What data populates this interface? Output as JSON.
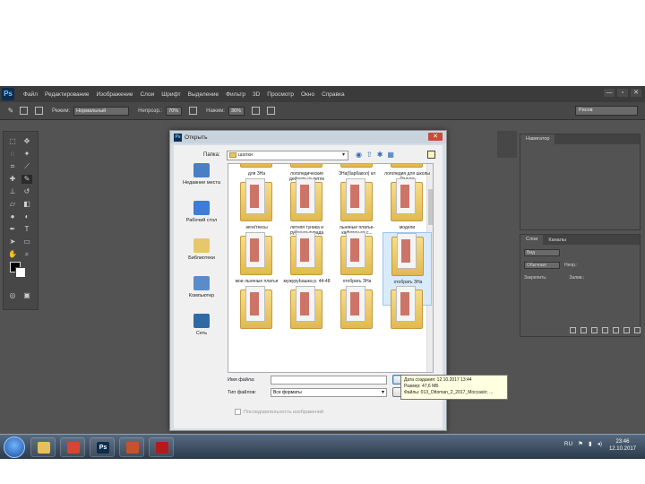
{
  "app": {
    "logo": "Ps",
    "menu": [
      "Файл",
      "Редактирование",
      "Изображение",
      "Слои",
      "Шрифт",
      "Выделение",
      "Фильтр",
      "3D",
      "Просмотр",
      "Окно",
      "Справка"
    ],
    "window_controls": [
      "—",
      "▫",
      "✕"
    ]
  },
  "options_bar": {
    "mode_label": "Режим:",
    "mode_value": "Нормальный",
    "opacity_label": "Непрозр.:",
    "opacity_value": "70%",
    "flow_label": "Нажим:",
    "flow_value": "36%",
    "workspace": "Рисов"
  },
  "panels": {
    "navigator_tab": "Навигатор",
    "layers_tabs": [
      "Слои",
      "Каналы"
    ],
    "layers_kind": "Вид",
    "layers_blend": "Обычные",
    "layers_opacity": "Непр.:",
    "layers_lock": "Закрепить:",
    "layers_fill": "Залив.:"
  },
  "dialog": {
    "title": "Открыть",
    "look_in_label": "Папка:",
    "look_in_value": "шапки",
    "places": [
      {
        "label": "Недавние места",
        "icon": "recent-places-icon",
        "color": "#4a7fc4"
      },
      {
        "label": "Рабочий стол",
        "icon": "desktop-icon",
        "color": "#3b7dd8"
      },
      {
        "label": "Библиотеки",
        "icon": "libraries-icon",
        "color": "#e8c66a"
      },
      {
        "label": "Компьютер",
        "icon": "computer-icon",
        "color": "#5a8cc9"
      },
      {
        "label": "Сеть",
        "icon": "network-icon",
        "color": "#2f6aa6"
      }
    ],
    "files": [
      {
        "name": "для ЗНа"
      },
      {
        "name": "логопедические дефекты в детях"
      },
      {
        "name": "ЗНа(барбакол) кл"
      },
      {
        "name": "логопедия для школы Радуги"
      },
      {
        "name": "зеги/тексы"
      },
      {
        "name": "летняя туника и рубашка турада"
      },
      {
        "name": "льняные платье-кафетан со с..."
      },
      {
        "name": "модели"
      },
      {
        "name": "мои льняные платья"
      },
      {
        "name": "мужуруЬашка р. 44-48"
      },
      {
        "name": "отобрать ЗНа"
      },
      {
        "name": "отобрать ЗНа"
      },
      {
        "name": ""
      },
      {
        "name": ""
      },
      {
        "name": ""
      },
      {
        "name": ""
      }
    ],
    "tooltip": {
      "line1": "Дата создания: 12.10.2017 13:44",
      "line2": "Размер: 47,6 МБ",
      "line3": "Файлы: 013_Ottoman_2_2017_Moccasin; ..."
    },
    "filename_label": "Имя файла:",
    "filename_value": "",
    "filetype_label": "Тип файлов:",
    "filetype_value": "Все форматы",
    "open_button": "Открыть",
    "cancel_button": "Отмена",
    "sequence_label": "Последовательность изображений"
  },
  "taskbar": {
    "apps": [
      {
        "icon": "explorer-icon",
        "glyph": "",
        "color": "#e6c15a"
      },
      {
        "icon": "chrome-icon",
        "glyph": "",
        "color": "#d7462f"
      },
      {
        "icon": "photoshop-icon",
        "glyph": "Ps",
        "color": "#0d2d4f"
      },
      {
        "icon": "powerpoint-icon",
        "glyph": "",
        "color": "#c8522b"
      },
      {
        "icon": "acrobat-icon",
        "glyph": "",
        "color": "#b21b1b"
      }
    ],
    "lang": "RU",
    "time": "23:46",
    "date": "12.10.2017"
  }
}
